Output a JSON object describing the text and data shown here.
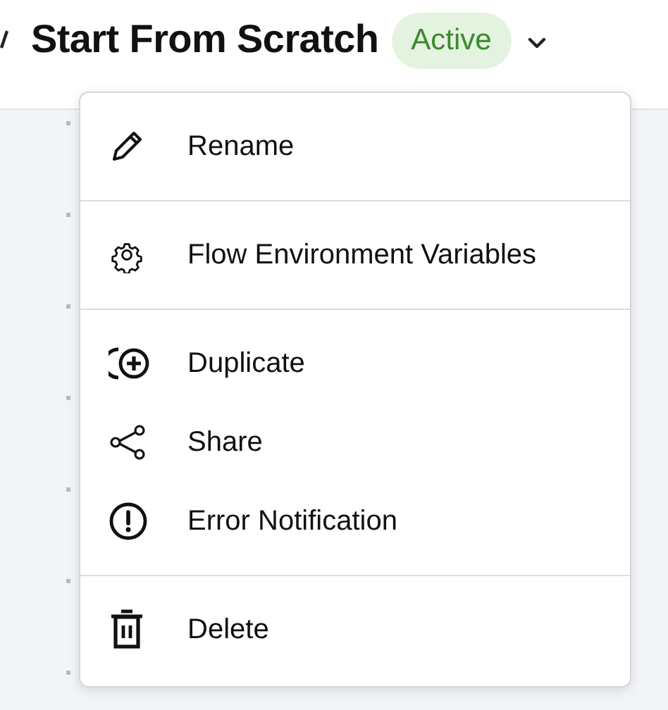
{
  "header": {
    "title": "Start From Scratch",
    "status": {
      "label": "Active",
      "kind": "active"
    }
  },
  "menu": {
    "sections": [
      [
        {
          "kind": "rename",
          "label": "Rename"
        }
      ],
      [
        {
          "kind": "variables",
          "label": "Flow Environment Variables"
        }
      ],
      [
        {
          "kind": "duplicate",
          "label": "Duplicate"
        },
        {
          "kind": "share",
          "label": "Share"
        },
        {
          "kind": "error",
          "label": "Error Notification"
        }
      ],
      [
        {
          "kind": "delete",
          "label": "Delete"
        }
      ]
    ]
  }
}
